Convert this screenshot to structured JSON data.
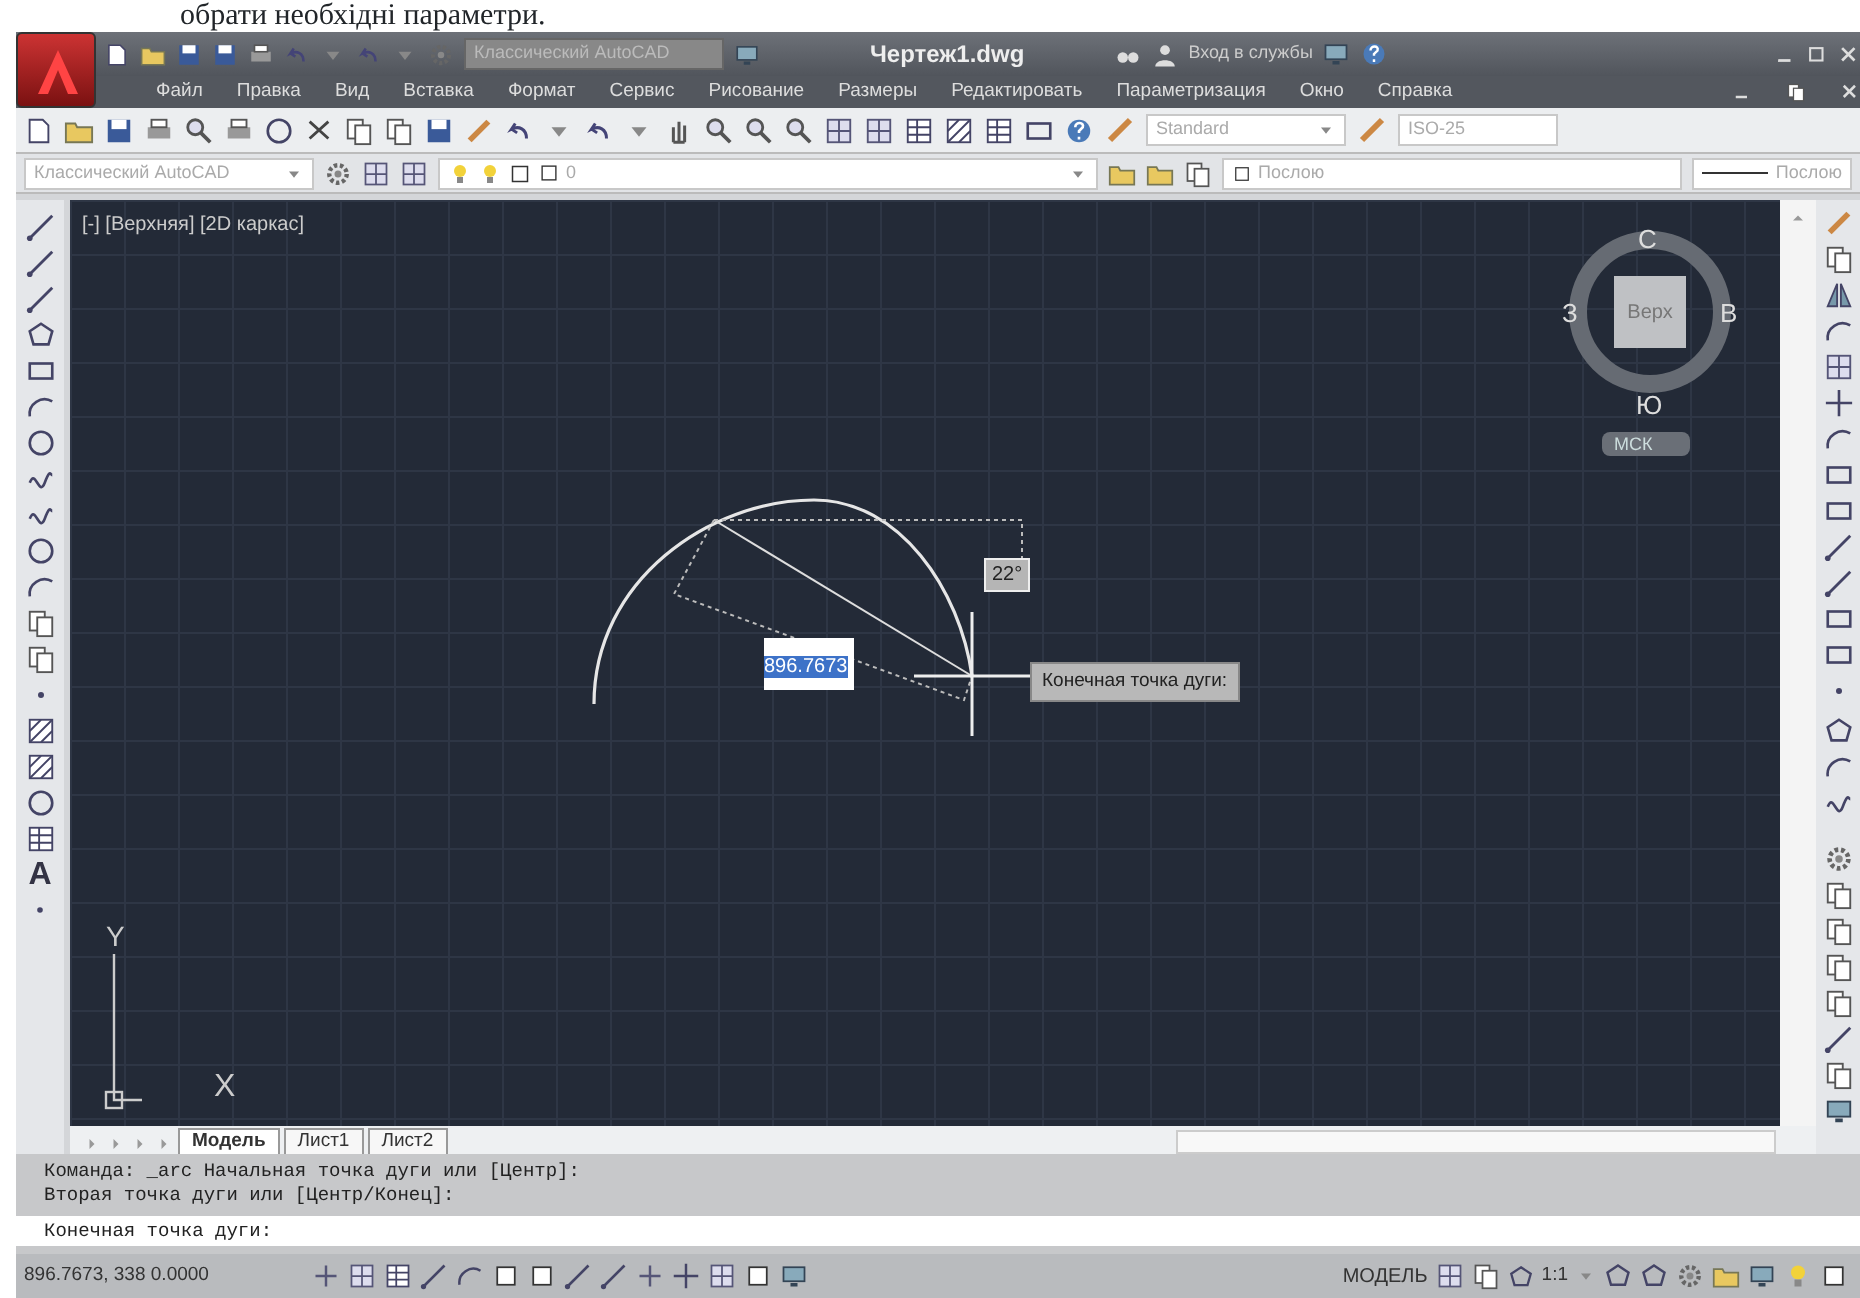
{
  "document_text": "обрати необхідні параметри.",
  "title_bar": {
    "workspace": "Классический AutoCAD",
    "title": "Чертеж1.dwg",
    "sign_in": "Вход в службы"
  },
  "menu": [
    "Файл",
    "Правка",
    "Вид",
    "Вставка",
    "Формат",
    "Сервис",
    "Рисование",
    "Размеры",
    "Редактировать",
    "Параметризация",
    "Окно",
    "Справка"
  ],
  "standard_toolbar": {
    "text_style": "Standard",
    "dim_style": "ISO-25"
  },
  "layers_toolbar": {
    "workspace": "Классический AutoCAD",
    "layer": "0",
    "color_setting": "Послою",
    "linetype": "Послою"
  },
  "draw_toolbar": {
    "text_tool": "A"
  },
  "viewport": {
    "label": "[-] [Верхняя] [2D каркас]",
    "viewcube": {
      "north": "С",
      "south": "Ю",
      "west": "З",
      "east": "В",
      "face": "Верх",
      "ucs": "МСК"
    },
    "dimension_input": "896.7673",
    "angle": "22°",
    "tooltip": "Конечная точка дуги:",
    "ucs_icon": {
      "x": "X",
      "y": "Y"
    }
  },
  "layout_tabs": [
    {
      "label": "Модель",
      "selected": true
    },
    {
      "label": "Лист1",
      "selected": false
    },
    {
      "label": "Лист2",
      "selected": false
    }
  ],
  "command_history": [
    "Команда: _arc Начальная точка дуги или [Центр]:",
    "Вторая точка дуги или [Центр/Конец]:"
  ],
  "command_line": "Конечная точка дуги:",
  "status_bar": {
    "coordinates": "896.7673, 338 0.0000",
    "model": "МОДЕЛЬ",
    "scale": "1:1"
  }
}
